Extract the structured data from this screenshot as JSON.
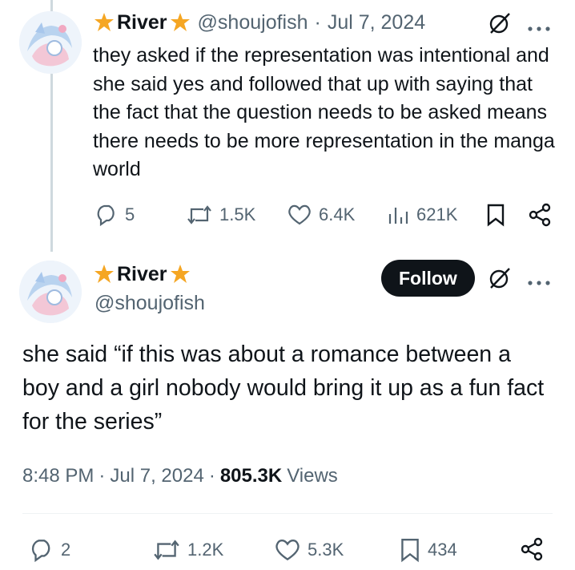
{
  "reply_tweet": {
    "display_name": "River",
    "handle": "@shoujofish",
    "separator": "·",
    "date": "Jul 7, 2024",
    "text": "they asked if the representation was intentional and she said yes and followed that up with saying that the fact that the question needs to be asked means there needs to be more representation in the manga world",
    "actions": {
      "replies": "5",
      "retweets": "1.5K",
      "likes": "6.4K",
      "views": "621K"
    }
  },
  "main_tweet": {
    "display_name": "River",
    "handle": "@shoujofish",
    "follow_label": "Follow",
    "text": "she said “if this was about a romance between a boy and a girl nobody would bring it up as a fun fact for the series”",
    "time": "8:48 PM",
    "date": "Jul 7, 2024",
    "views_count": "805.3K",
    "views_label": "Views",
    "actions": {
      "replies": "2",
      "retweets": "1.2K",
      "likes": "5.3K",
      "bookmarks": "434"
    }
  },
  "icons": [
    "star-badge-icon",
    "grok-icon",
    "more-icon",
    "reply-icon",
    "retweet-icon",
    "like-icon",
    "views-icon",
    "bookmark-icon",
    "share-icon"
  ],
  "colors": {
    "text": "#0f1419",
    "secondary": "#536471",
    "badge": "#f5a623",
    "thread_line": "#cfd9de"
  }
}
